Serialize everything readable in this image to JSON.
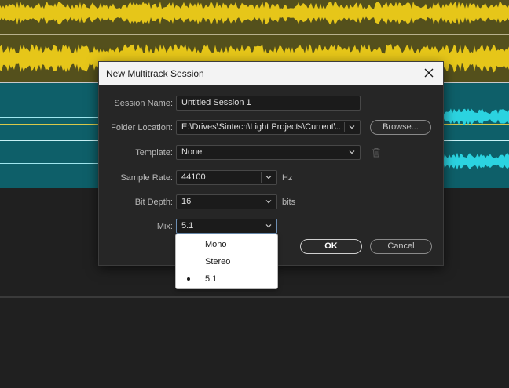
{
  "dialog": {
    "title": "New Multitrack Session",
    "fields": {
      "session_name": {
        "label": "Session Name:",
        "value": "Untitled Session 1"
      },
      "folder_location": {
        "label": "Folder Location:",
        "value": "E:\\Drives\\Sintech\\Light Projects\\Current\\..."
      },
      "template": {
        "label": "Template:",
        "value": "None"
      },
      "sample_rate": {
        "label": "Sample Rate:",
        "value": "44100",
        "unit": "Hz"
      },
      "bit_depth": {
        "label": "Bit Depth:",
        "value": "16",
        "unit": "bits"
      },
      "mix": {
        "label": "Mix:",
        "value": "5.1"
      }
    },
    "buttons": {
      "browse": "Browse...",
      "ok": "OK",
      "cancel": "Cancel"
    }
  },
  "mix_menu": {
    "items": [
      {
        "label": "Mono",
        "selected": false
      },
      {
        "label": "Stereo",
        "selected": false
      },
      {
        "label": "5.1",
        "selected": true
      }
    ]
  },
  "colors": {
    "track_yellow": "#e6c619",
    "track_teal": "#2bd3e0",
    "accent_focus": "#4a90d9"
  },
  "icons": [
    "close-icon",
    "chevron-down-icon",
    "trash-icon",
    "bullet-icon"
  ]
}
